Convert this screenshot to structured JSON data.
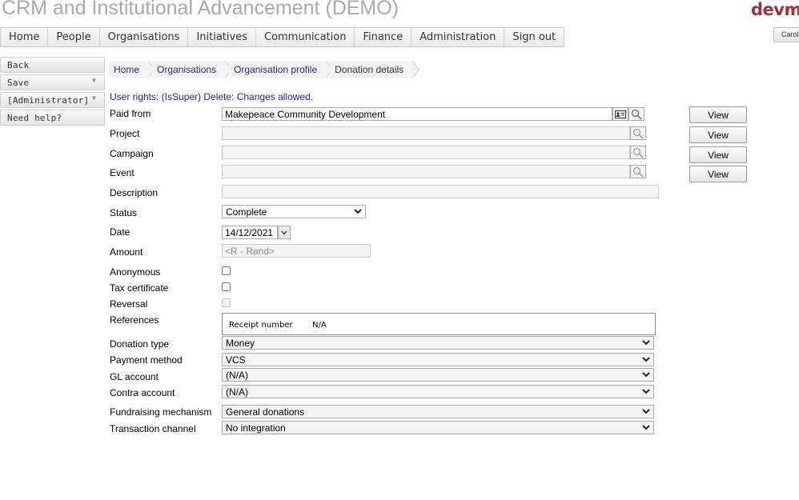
{
  "app": {
    "title": "CRM and Institutional Advancement (DEMO)",
    "logo": "devm",
    "user_label": "Carol"
  },
  "menu": [
    "Home",
    "People",
    "Organisations",
    "Initiatives",
    "Communication",
    "Finance",
    "Administration",
    "Sign out"
  ],
  "sidebar": {
    "back": "Back",
    "save": "Save",
    "role": "[Administrator]",
    "help": "Need help?"
  },
  "breadcrumb": [
    "Home",
    "Organisations",
    "Organisation profile",
    "Donation details"
  ],
  "rights_text": "User rights: (IsSuper) Delete: Changes allowed.",
  "form": {
    "paid_from": {
      "label": "Paid from",
      "value": "Makepeace Community Development"
    },
    "project": {
      "label": "Project",
      "value": ""
    },
    "campaign": {
      "label": "Campaign",
      "value": ""
    },
    "event": {
      "label": "Event",
      "value": ""
    },
    "description": {
      "label": "Description",
      "value": ""
    },
    "status": {
      "label": "Status",
      "value": "Complete"
    },
    "date": {
      "label": "Date",
      "value": "14/12/2021"
    },
    "amount": {
      "label": "Amount",
      "placeholder": "<R - Rand>"
    },
    "anonymous": {
      "label": "Anonymous",
      "checked": false
    },
    "tax_certificate": {
      "label": "Tax certificate",
      "checked": false
    },
    "reversal": {
      "label": "Reversal",
      "checked": false
    },
    "references": {
      "label": "References",
      "key": "Receipt number",
      "value": "N/A"
    },
    "donation_type": {
      "label": "Donation type",
      "value": "Money"
    },
    "payment_method": {
      "label": "Payment method",
      "value": "VCS"
    },
    "gl_account": {
      "label": "GL account",
      "value": "(N/A)"
    },
    "contra_account": {
      "label": "Contra account",
      "value": "(N/A)"
    },
    "fundraising_mechanism": {
      "label": "Fundraising mechanism",
      "value": "General donations"
    },
    "transaction_channel": {
      "label": "Transaction channel",
      "value": "No integration"
    }
  },
  "view_label": "View",
  "colors": {
    "title": "#a9a9a9",
    "logo": "#a0303b",
    "rights": "#2222aa",
    "link": "#2c2c6c"
  }
}
